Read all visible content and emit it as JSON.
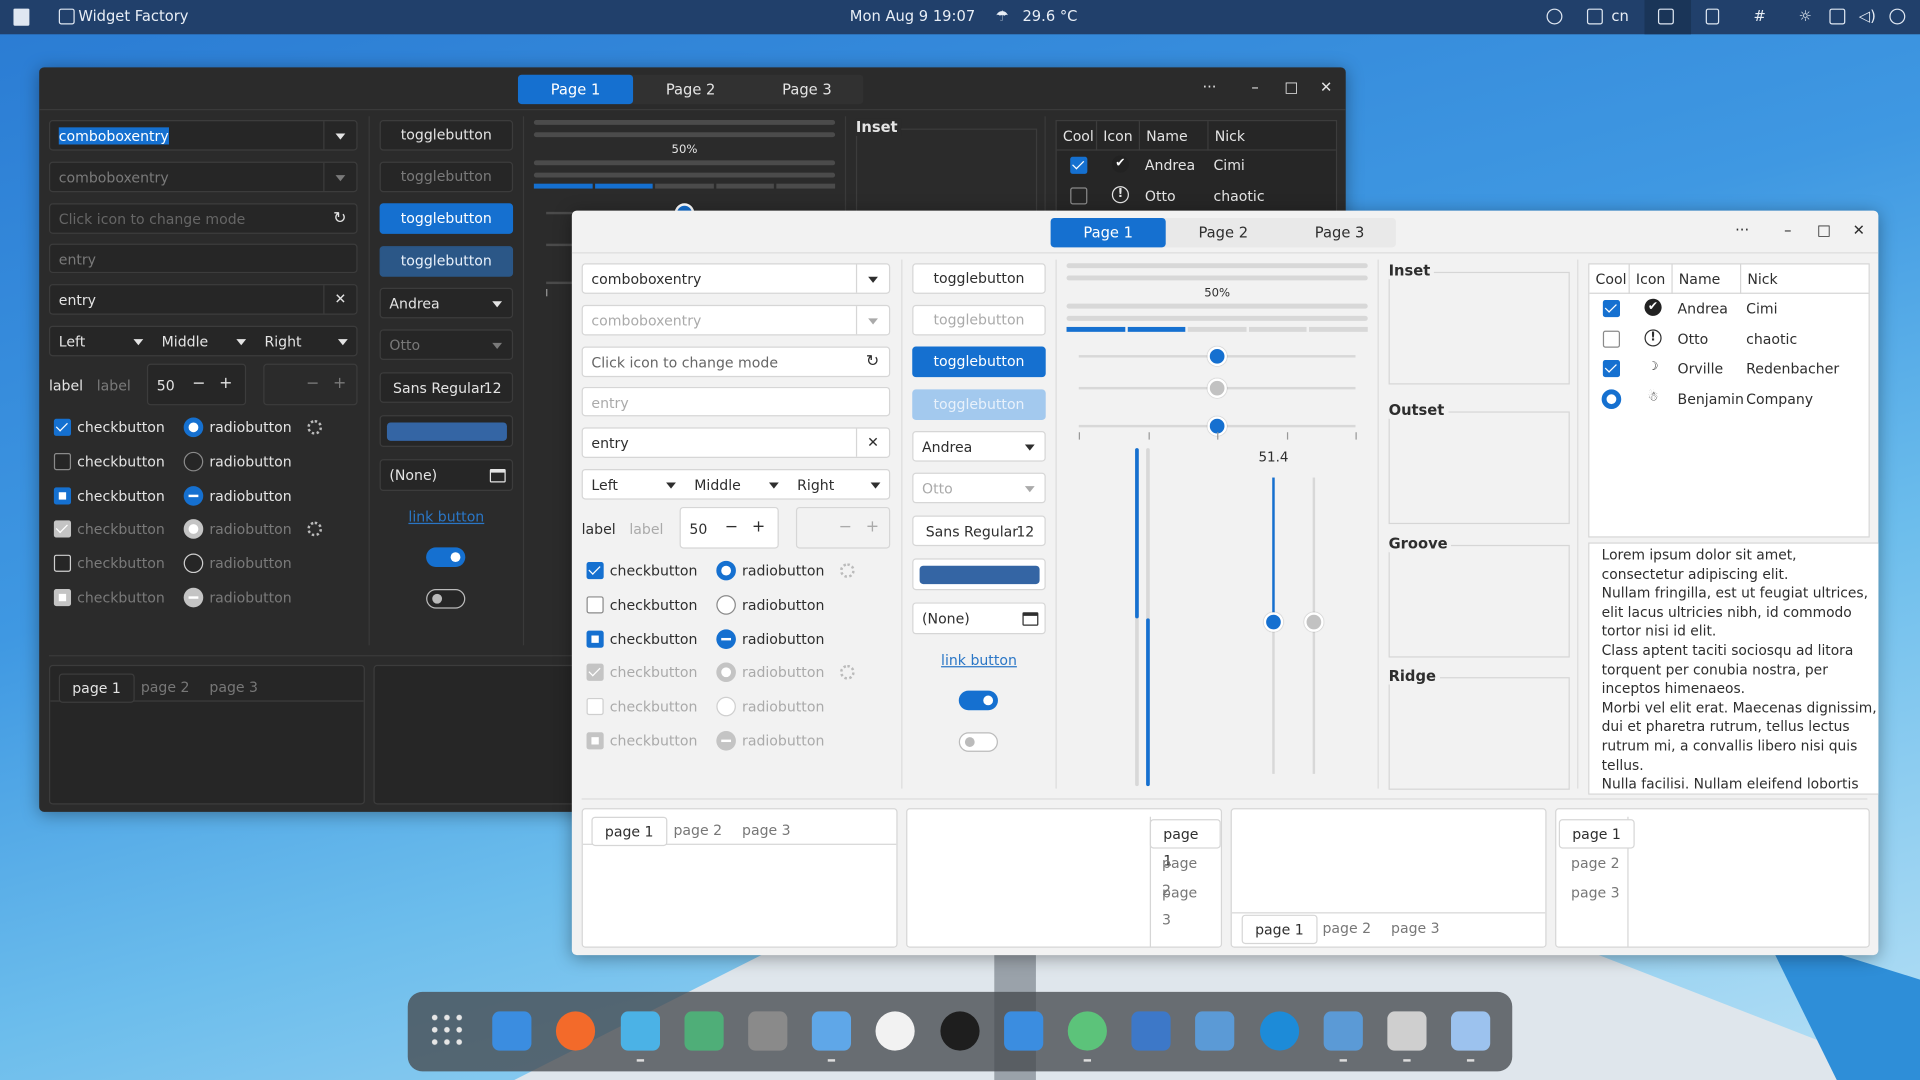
{
  "topbar": {
    "app_title": "Widget Factory",
    "datetime": "Mon Aug 9  19:07",
    "weather": "29.6 °C",
    "keyboard_layout": "cn"
  },
  "window": {
    "tabs": [
      "Page 1",
      "Page 2",
      "Page 3"
    ],
    "active_tab": "Page 1",
    "more": "···",
    "minimize": "–",
    "maximize": "□",
    "close": "✕"
  },
  "col1": {
    "combo1": "comboboxentry",
    "combo2": "comboboxentry",
    "mode_placeholder": "Click icon to change mode",
    "entry_placeholder": "entry",
    "entry_value": "entry",
    "lmr": [
      "Left",
      "Middle",
      "Right"
    ],
    "label1": "label",
    "label2": "label",
    "spin_value": "50",
    "spin_minus": "−",
    "spin_plus": "+",
    "check_label": "checkbutton",
    "radio_label": "radiobutton",
    "rows": [
      {
        "check": "checked",
        "radio": "checked",
        "spinner": true,
        "disabled": false
      },
      {
        "check": "unchecked",
        "radio": "unchecked",
        "spinner": false,
        "disabled": false
      },
      {
        "check": "mixed",
        "radio": "mixed",
        "spinner": false,
        "disabled": false
      },
      {
        "check": "checked",
        "radio": "checked",
        "spinner": true,
        "disabled": true
      },
      {
        "check": "unchecked",
        "radio": "unchecked",
        "spinner": false,
        "disabled": true
      },
      {
        "check": "mixed",
        "radio": "mixed",
        "spinner": false,
        "disabled": true
      }
    ]
  },
  "col2": {
    "toggle": "togglebutton",
    "combo_andrea": "Andrea",
    "combo_otto": "Otto",
    "font": "Sans Regular",
    "font_size": "12",
    "color_value": "#3465a4",
    "file": "(None)",
    "link": "link button",
    "switch1_on": true,
    "switch2_on": false
  },
  "progress": {
    "label": "50%",
    "bars": [
      0.5,
      0.5,
      0.2,
      0.6,
      0.4
    ]
  },
  "scales": {
    "h1": 0.5,
    "h2": 0.5,
    "h3": 0.5,
    "vscale_label": "51.4",
    "vscale_value": 51.4
  },
  "frames": [
    "Inset",
    "Outset",
    "Groove",
    "Ridge"
  ],
  "tree": {
    "columns": [
      "Cool",
      "Icon",
      "Name",
      "Nick"
    ],
    "rows": [
      {
        "cool": "checked",
        "icon": "check-circle-icon",
        "name": "Andrea",
        "nick": "Cimi"
      },
      {
        "cool": "unchecked",
        "icon": "exclamation-circle-icon",
        "name": "Otto",
        "nick": "chaotic"
      },
      {
        "cool": "checked",
        "icon": "moon-face-icon",
        "name": "Orville",
        "nick": "Redenbacher"
      },
      {
        "cool": "radio",
        "icon": "bug-icon",
        "name": "Benjamin",
        "nick": "Company"
      }
    ]
  },
  "textview": "Lorem ipsum dolor sit amet, consectetur adipiscing elit.\nNullam fringilla, est ut feugiat ultrices, elit lacus ultricies nibh, id commodo tortor nisi id elit.\nClass aptent taciti sociosqu ad litora torquent per conubia nostra, per inceptos himenaeos.\nMorbi vel elit erat. Maecenas dignissim, dui et pharetra rutrum, tellus lectus rutrum mi, a convallis libero nisi quis tellus.\nNulla facilisi. Nullam eleifend lobortis nisl.",
  "notebooks": {
    "tabs": [
      "page 1",
      "page 2",
      "page 3"
    ]
  },
  "dock": [
    {
      "name": "app-grid",
      "color": "#e0e0e0"
    },
    {
      "name": "files",
      "color": "#3b8de0"
    },
    {
      "name": "firefox",
      "color": "#f36a2a"
    },
    {
      "name": "mail",
      "color": "#4bb2e6",
      "running": true
    },
    {
      "name": "terminal-green",
      "color": "#4fae78",
      "running": false
    },
    {
      "name": "inkscape",
      "color": "#8a8a8a"
    },
    {
      "name": "settings-panel",
      "color": "#5fa7e8",
      "running": true
    },
    {
      "name": "github",
      "color": "#f2f2f2"
    },
    {
      "name": "figma",
      "color": "#1e1e1e"
    },
    {
      "name": "folder",
      "color": "#3b8de0"
    },
    {
      "name": "atom",
      "color": "#5cc37a",
      "running": true
    },
    {
      "name": "disks",
      "color": "#3d78c8"
    },
    {
      "name": "tweaks",
      "color": "#5b9ad6"
    },
    {
      "name": "edge-beta",
      "color": "#1d8bd8"
    },
    {
      "name": "tweaks-2",
      "color": "#5b9ad6",
      "running": true
    },
    {
      "name": "terminal",
      "color": "#cfcfcf",
      "running": true
    },
    {
      "name": "store",
      "color": "#9cc2ee",
      "running": true
    }
  ],
  "colors": {
    "accent": "#1570d0",
    "topbar": "#21406b",
    "dark_window": "#2b2b2b",
    "light_window": "#f2f2f2"
  }
}
